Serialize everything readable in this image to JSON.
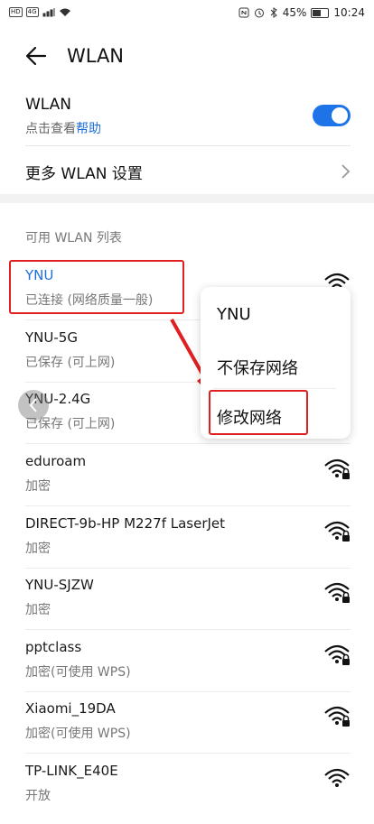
{
  "status_bar": {
    "left_tags": [
      "HD",
      "4G"
    ],
    "battery": "45%",
    "battery_level": 0.45,
    "time": "10:24"
  },
  "header": {
    "title": "WLAN",
    "back_icon": "back-arrow-icon"
  },
  "wlan_toggle": {
    "label": "WLAN",
    "sub_prefix": "点击查看",
    "help": "帮助",
    "enabled": true,
    "accent": "#1e73e8"
  },
  "more_settings": {
    "label": "更多 WLAN 设置"
  },
  "list": {
    "title": "可用 WLAN 列表",
    "networks": [
      {
        "name": "YNU",
        "status": "已连接 (网络质量一般)",
        "active": true,
        "locked": false
      },
      {
        "name": "YNU-5G",
        "status": "已保存 (可上网)",
        "active": false,
        "locked": false
      },
      {
        "name": "YNU-2.4G",
        "status": "已保存 (可上网)",
        "active": false,
        "locked": false
      },
      {
        "name": "eduroam",
        "status": "加密",
        "active": false,
        "locked": true
      },
      {
        "name": "DIRECT-9b-HP M227f LaserJet",
        "status": "加密",
        "active": false,
        "locked": true
      },
      {
        "name": "YNU-SJZW",
        "status": "加密",
        "active": false,
        "locked": true
      },
      {
        "name": "pptclass",
        "status": "加密(可使用 WPS)",
        "active": false,
        "locked": true
      },
      {
        "name": "Xiaomi_19DA",
        "status": "加密(可使用 WPS)",
        "active": false,
        "locked": true
      },
      {
        "name": "TP-LINK_E40E",
        "status": "开放",
        "active": false,
        "locked": false
      }
    ]
  },
  "context_menu": {
    "title": "YNU",
    "items": [
      "不保存网络",
      "修改网络"
    ]
  },
  "colors": {
    "highlight": "#e02020",
    "link": "#1e6fd9"
  }
}
